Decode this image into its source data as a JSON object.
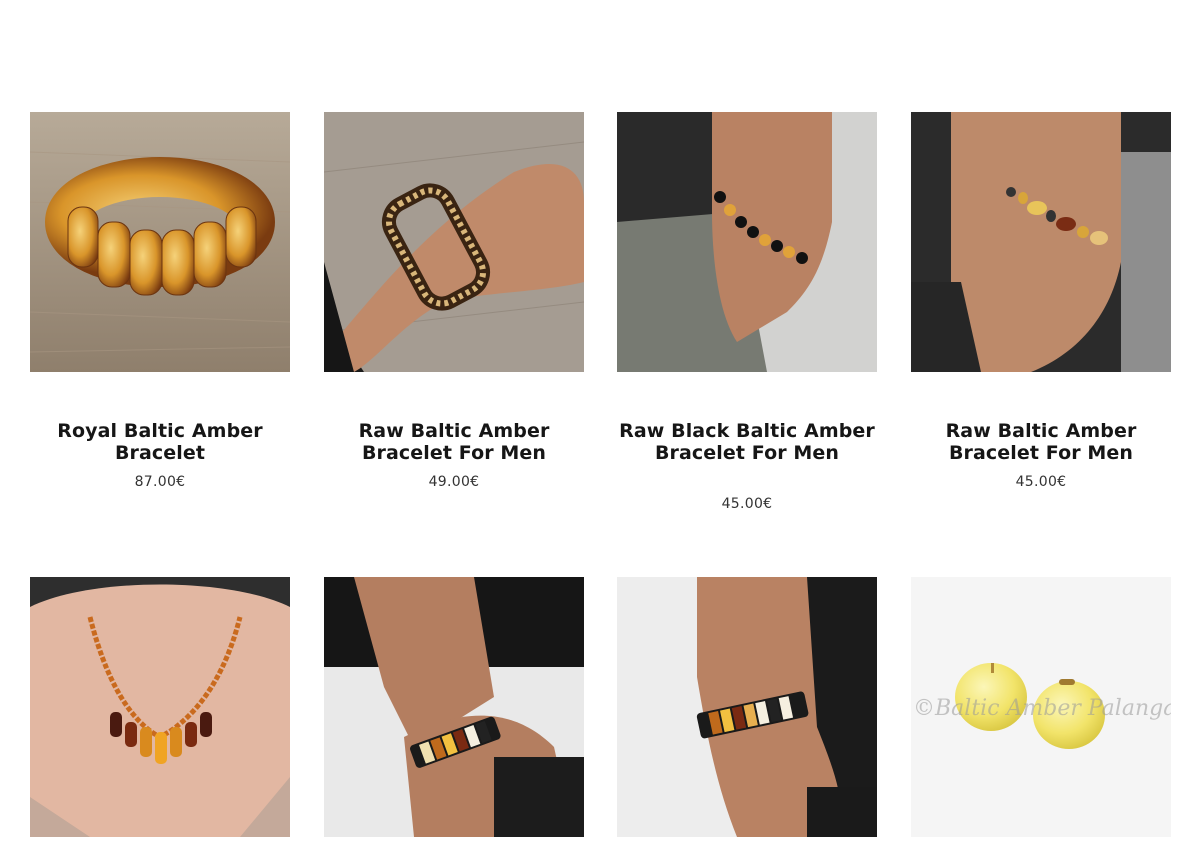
{
  "products": [
    {
      "title": "Royal Baltic Amber Bracelet",
      "price": "87.00€"
    },
    {
      "title": "Raw Baltic Amber Bracelet For Men",
      "price": "49.00€"
    },
    {
      "title": "Raw Black Baltic Amber Bracelet For Men",
      "price": "45.00€"
    },
    {
      "title": "Raw Baltic Amber Bracelet For Men",
      "price": "45.00€"
    },
    {
      "title": "",
      "price": ""
    },
    {
      "title": "",
      "price": ""
    },
    {
      "title": "",
      "price": ""
    },
    {
      "title": "",
      "price": ""
    }
  ],
  "watermark": "©Baltic Amber Palanga",
  "colors": {
    "amber": "#d9952a",
    "dark_amber": "#8a3f12",
    "lemon": "#f2e46a",
    "text": "#161616"
  }
}
